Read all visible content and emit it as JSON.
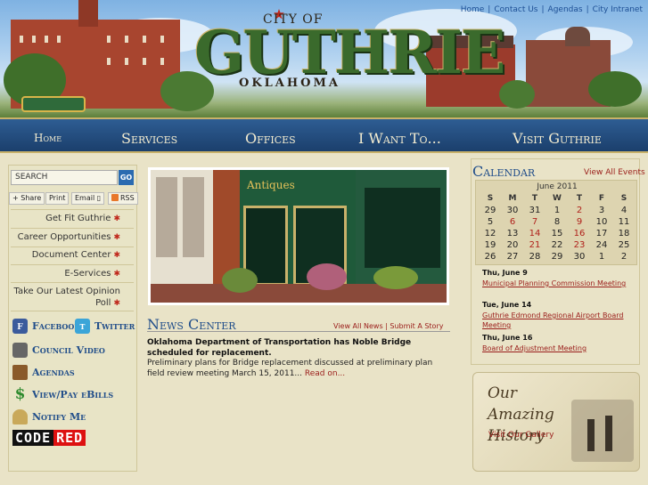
{
  "top_links": [
    "Home",
    "Contact Us",
    "Agendas",
    "City Intranet"
  ],
  "logo": {
    "city": "CITY OF",
    "name": "GUTHRIE",
    "state": "OKLAHOMA"
  },
  "nav": [
    "Home",
    "Services",
    "Offices",
    "I Want To...",
    "Visit Guthrie"
  ],
  "search": {
    "value": "SEARCH",
    "button": "GO"
  },
  "tools": {
    "share": "Share",
    "print": "Print",
    "email": "Email",
    "rss": "RSS"
  },
  "side_links": [
    "Get Fit Guthrie",
    "Career Opportunities",
    "Document Center",
    "E-Services",
    "Take Our Latest Opinion",
    "Poll"
  ],
  "social": {
    "facebook": "Facebook",
    "twitter": "Twitter"
  },
  "quick_links": [
    "Council Video",
    "Agendas",
    "View/Pay eBills",
    "Notify Me"
  ],
  "codered": {
    "code": "CODE",
    "red": "RED"
  },
  "photo": {
    "sign": "Antiques"
  },
  "news": {
    "title": "News Center",
    "view_all": "View All News",
    "submit": "Submit A Story",
    "headline": "Oklahoma Department of Transportation has Noble Bridge scheduled for replacement.",
    "body": "Preliminary plans for Bridge replacement discussed at preliminary plan field review meeting March 15, 2011...",
    "read_on": "Read on..."
  },
  "calendar": {
    "title": "Calendar",
    "view_all": "View All Events",
    "month": "June 2011",
    "day_headers": [
      "S",
      "M",
      "T",
      "W",
      "T",
      "F",
      "S"
    ],
    "weeks": [
      [
        "29",
        "30",
        "31",
        "1",
        "2",
        "3",
        "4"
      ],
      [
        "5",
        "6",
        "7",
        "8",
        "9",
        "10",
        "11"
      ],
      [
        "12",
        "13",
        "14",
        "15",
        "16",
        "17",
        "18"
      ],
      [
        "19",
        "20",
        "21",
        "22",
        "23",
        "24",
        "25"
      ],
      [
        "26",
        "27",
        "28",
        "29",
        "30",
        "1",
        "2"
      ]
    ],
    "event_days": [
      "2",
      "6",
      "7",
      "9",
      "14",
      "16",
      "21",
      "23"
    ],
    "events": [
      {
        "date": "Thu, June 9",
        "title": "Municipal Planning Commission Meeting"
      },
      {
        "date": "Tue, June 14",
        "title": "Guthrie Edmond Regional Airport Board Meeting"
      },
      {
        "date": "Thu, June 16",
        "title": "Board of Adjustment Meeting"
      }
    ]
  },
  "history": {
    "title_1": "Our Amazing",
    "title_2": "History",
    "link": "Visit Our Gallery"
  },
  "colors": {
    "nav": "#1b3f6c",
    "accent_red": "#9a1d1a",
    "heading_blue": "#214e8a",
    "panel": "#e9e3c7"
  }
}
